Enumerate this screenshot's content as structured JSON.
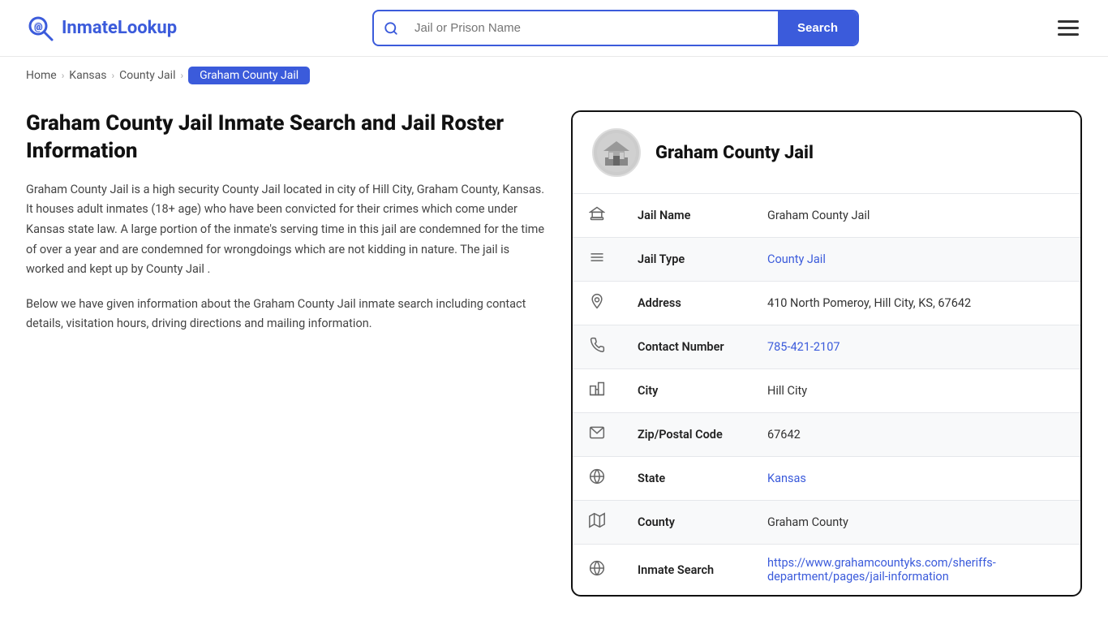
{
  "header": {
    "logo_text_part1": "Inmate",
    "logo_text_part2": "Lookup",
    "search_placeholder": "Jail or Prison Name",
    "search_button_label": "Search"
  },
  "breadcrumb": {
    "home": "Home",
    "state": "Kansas",
    "type": "County Jail",
    "current": "Graham County Jail"
  },
  "left": {
    "page_title": "Graham County Jail Inmate Search and Jail Roster Information",
    "desc1": "Graham County Jail is a high security County Jail located in city of Hill City, Graham County, Kansas. It houses adult inmates (18+ age) who have been convicted for their crimes which come under Kansas state law. A large portion of the inmate's serving time in this jail are condemned for the time of over a year and are condemned for wrongdoings which are not kidding in nature. The jail is worked and kept up by County Jail .",
    "desc2": "Below we have given information about the Graham County Jail inmate search including contact details, visitation hours, driving directions and mailing information."
  },
  "card": {
    "title": "Graham County Jail",
    "avatar_emoji": "🏛️",
    "rows": [
      {
        "icon": "🏛",
        "label": "Jail Name",
        "value": "Graham County Jail",
        "link": null
      },
      {
        "icon": "≡",
        "label": "Jail Type",
        "value": "County Jail",
        "link": "#"
      },
      {
        "icon": "📍",
        "label": "Address",
        "value": "410 North Pomeroy, Hill City, KS, 67642",
        "link": null
      },
      {
        "icon": "📞",
        "label": "Contact Number",
        "value": "785-421-2107",
        "link": "tel:785-421-2107"
      },
      {
        "icon": "🏙",
        "label": "City",
        "value": "Hill City",
        "link": null
      },
      {
        "icon": "✉",
        "label": "Zip/Postal Code",
        "value": "67642",
        "link": null
      },
      {
        "icon": "🌐",
        "label": "State",
        "value": "Kansas",
        "link": "#"
      },
      {
        "icon": "🗺",
        "label": "County",
        "value": "Graham County",
        "link": null
      },
      {
        "icon": "🌐",
        "label": "Inmate Search",
        "value": "https://www.grahamcountyks.com/sheriffs-department/pages/jail-information",
        "link": "https://www.grahamcountyks.com/sheriffs-department/pages/jail-information"
      }
    ]
  }
}
